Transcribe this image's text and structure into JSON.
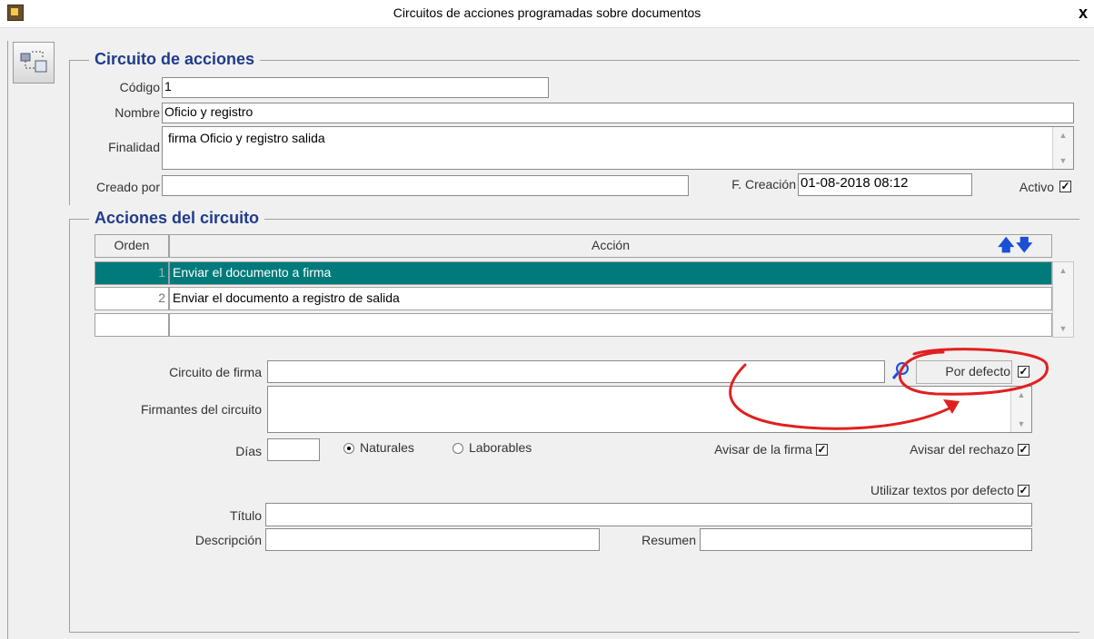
{
  "window": {
    "title": "Circuitos de acciones programadas sobre documentos",
    "close": "x"
  },
  "circuit": {
    "group_title": "Circuito de acciones",
    "codigo_label": "Código",
    "codigo_value": "1",
    "nombre_label": "Nombre",
    "nombre_value": "Oficio y registro",
    "finalidad_label": "Finalidad",
    "finalidad_value": "firma Oficio y registro salida",
    "creado_label": "Creado por",
    "creado_value": "",
    "fecha_label": "F. Creación",
    "fecha_value": "01-08-2018 08:12",
    "activo_label": "Activo",
    "activo_checked": "✓"
  },
  "actions": {
    "group_title": "Acciones del circuito",
    "columns": {
      "orden": "Orden",
      "accion": "Acción"
    },
    "rows": [
      {
        "orden": "1",
        "accion": "Enviar el documento a firma"
      },
      {
        "orden": "2",
        "accion": "Enviar el documento a registro de salida"
      },
      {
        "orden": "",
        "accion": ""
      }
    ],
    "up_arrow": "🡅",
    "down_arrow": "🡇"
  },
  "firma": {
    "circuito_label": "Circuito de firma",
    "circuito_value": "",
    "por_defecto_label": "Por defecto",
    "por_defecto_checked": "✓",
    "firmantes_label": "Firmantes del circuito",
    "firmantes_value": "",
    "dias_label": "Días",
    "dias_value": "",
    "naturales_label": "Naturales",
    "laborables_label": "Laborables",
    "avisar_firma_label": "Avisar de la firma",
    "avisar_firma_checked": "✓",
    "avisar_rechazo_label": "Avisar del rechazo",
    "avisar_rechazo_checked": "✓",
    "utilizar_textos_label": "Utilizar textos por defecto",
    "utilizar_textos_checked": "✓",
    "titulo_label": "Título",
    "titulo_value": "",
    "descripcion_label": "Descripción",
    "descripcion_value": "",
    "resumen_label": "Resumen",
    "resumen_value": ""
  },
  "annotation_color": "#e02020"
}
